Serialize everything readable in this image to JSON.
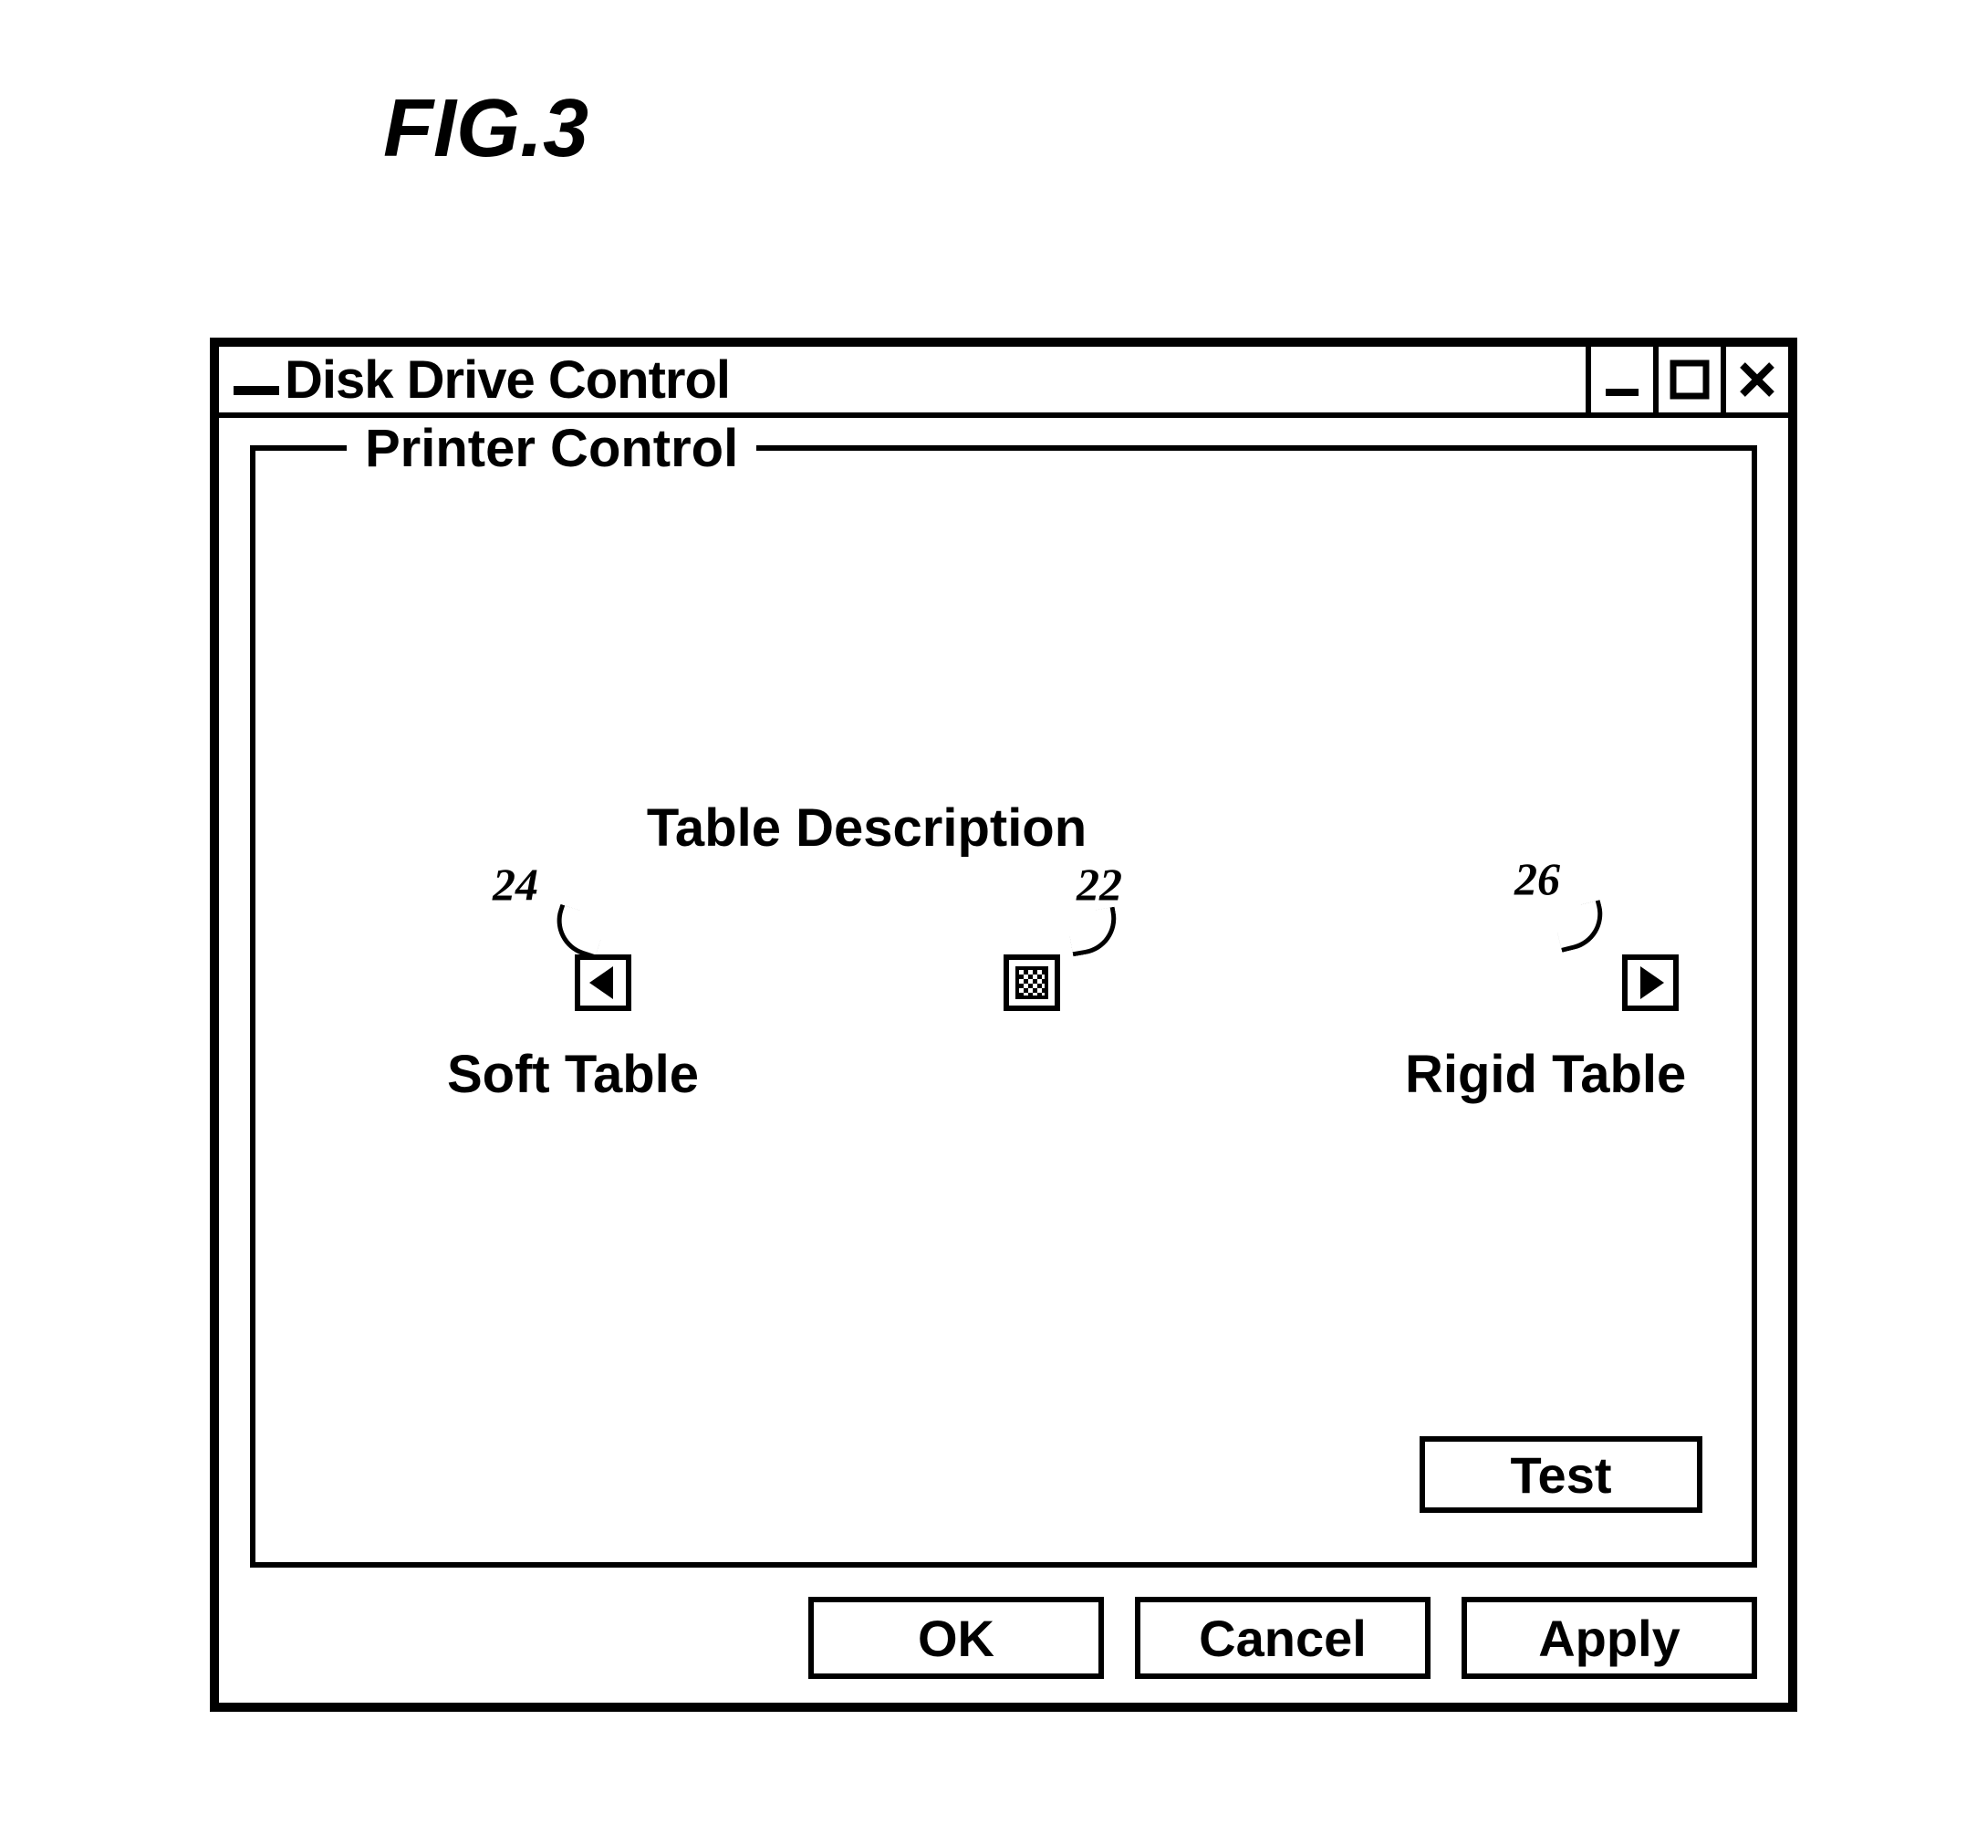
{
  "figure_label": "FIG.3",
  "window": {
    "title": "Disk Drive Control"
  },
  "groupbox": {
    "legend": "Printer Control",
    "table_description": "Table Description",
    "soft_label": "Soft Table",
    "rigid_label": "Rigid Table",
    "callouts": {
      "left": "24",
      "center": "22",
      "right": "26"
    },
    "test_label": "Test"
  },
  "buttons": {
    "ok": "OK",
    "cancel": "Cancel",
    "apply": "Apply"
  }
}
